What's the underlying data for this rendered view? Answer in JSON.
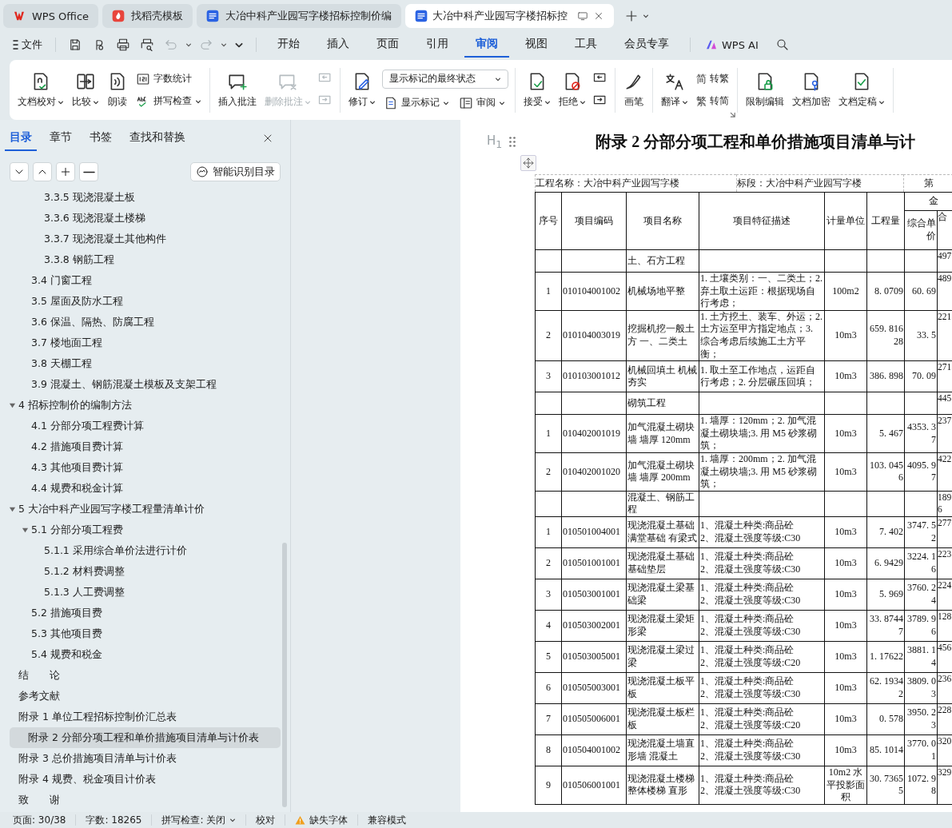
{
  "browser_tabs": [
    {
      "kind": "app",
      "label": "WPS Office",
      "selected": false
    },
    {
      "kind": "template",
      "label": "找稻壳模板",
      "selected": false
    },
    {
      "kind": "document",
      "label": "大冶中科产业园写字楼招标控制价编",
      "selected": false
    },
    {
      "kind": "document",
      "label": "大冶中科产业园写字楼招标控",
      "selected": true
    }
  ],
  "menu": {
    "file": "文件",
    "quick_actions": [
      {
        "disabled": false
      },
      {
        "disabled": false
      },
      {
        "disabled": false
      },
      {
        "disabled": false
      },
      {
        "disabled": true
      },
      {
        "disabled": true
      },
      {
        "disabled": false
      }
    ],
    "tabs": [
      {
        "label": "开始",
        "selected": false
      },
      {
        "label": "插入",
        "selected": false
      },
      {
        "label": "页面",
        "selected": false
      },
      {
        "label": "引用",
        "selected": false
      },
      {
        "label": "审阅",
        "selected": true
      },
      {
        "label": "视图",
        "selected": false
      },
      {
        "label": "工具",
        "selected": false
      },
      {
        "label": "会员专享",
        "selected": false
      }
    ],
    "ai": "WPS AI"
  },
  "ribbon": {
    "groups": [
      {
        "items": [
          {
            "kind": "large",
            "label": "文档校对",
            "dropdown": true,
            "disabled": false
          },
          {
            "kind": "large",
            "label": "比较",
            "dropdown": true,
            "disabled": false
          },
          {
            "kind": "large",
            "label": "朗读",
            "dropdown": false,
            "disabled": false
          },
          {
            "kind": "small",
            "label": "字数统计",
            "dropdown": false,
            "disabled": false
          },
          {
            "kind": "small",
            "label": "拼写检查",
            "dropdown": true,
            "disabled": false
          }
        ]
      },
      {
        "items": [
          {
            "kind": "large",
            "label": "插入批注",
            "dropdown": false,
            "disabled": false
          },
          {
            "kind": "large",
            "label": "删除批注",
            "dropdown": true,
            "disabled": true
          },
          {
            "kind": "icon",
            "disabled": true
          },
          {
            "kind": "icon",
            "disabled": true
          }
        ]
      },
      {
        "items": [
          {
            "kind": "large",
            "label": "修订",
            "dropdown": true,
            "disabled": false
          },
          {
            "kind": "select",
            "value": "显示标记的最终状态",
            "disabled": false
          },
          {
            "kind": "small",
            "label": "显示标记",
            "dropdown": true,
            "disabled": false
          },
          {
            "kind": "small",
            "label": "审阅",
            "dropdown": true,
            "disabled": false
          }
        ]
      },
      {
        "items": [
          {
            "kind": "large",
            "label": "接受",
            "dropdown": true,
            "disabled": false
          },
          {
            "kind": "large",
            "label": "拒绝",
            "dropdown": true,
            "disabled": false
          },
          {
            "kind": "icon",
            "disabled": false
          },
          {
            "kind": "icon",
            "disabled": false
          }
        ]
      },
      {
        "items": [
          {
            "kind": "large",
            "label": "画笔",
            "dropdown": false,
            "disabled": false
          }
        ]
      },
      {
        "launcher": true,
        "items": [
          {
            "kind": "large",
            "label": "翻译",
            "dropdown": true,
            "disabled": false
          },
          {
            "kind": "small",
            "glyph": "简",
            "label": "转繁",
            "dropdown": false,
            "disabled": false
          },
          {
            "kind": "small",
            "glyph": "繁",
            "label": "转简",
            "dropdown": false,
            "disabled": false
          }
        ]
      },
      {
        "items": [
          {
            "kind": "large",
            "label": "限制编辑",
            "dropdown": false,
            "disabled": false
          },
          {
            "kind": "large",
            "label": "文档加密",
            "dropdown": false,
            "disabled": false
          },
          {
            "kind": "large",
            "label": "文档定稿",
            "dropdown": true,
            "disabled": false
          }
        ]
      }
    ]
  },
  "sidebar": {
    "tabs": [
      {
        "label": "目录",
        "selected": true
      },
      {
        "label": "章节",
        "selected": false
      },
      {
        "label": "书签",
        "selected": false
      },
      {
        "label": "查找和替换",
        "selected": false
      }
    ],
    "smart_button": "智能识别目录",
    "outline": [
      {
        "children": [
          {
            "children": [
              {
                "label": "3.3.5 现浇混凝土板",
                "selected": false
              },
              {
                "label": "3.3.6 现浇混凝土楼梯",
                "selected": false
              },
              {
                "label": "3.3.7 现浇混凝土其他构件",
                "selected": false
              },
              {
                "label": "3.3.8 钢筋工程",
                "selected": false
              }
            ]
          },
          {
            "label": "3.4 门窗工程",
            "selected": false
          },
          {
            "label": "3.5 屋面及防水工程",
            "selected": false
          },
          {
            "label": "3.6 保温、隔热、防腐工程",
            "selected": false
          },
          {
            "label": "3.7 楼地面工程",
            "selected": false
          },
          {
            "label": "3.8 天棚工程",
            "selected": false
          },
          {
            "label": "3.9 混凝土、钢筋混凝土模板及支架工程",
            "selected": false
          }
        ]
      },
      {
        "label": "4 招标控制价的编制方法",
        "expanded": true,
        "selected": false,
        "children": [
          {
            "label": "4.1 分部分项工程费计算",
            "selected": false
          },
          {
            "label": "4.2 措施项目费计算",
            "selected": false
          },
          {
            "label": "4.3 其他项目费计算",
            "selected": false
          },
          {
            "label": "4.4 规费和税金计算",
            "selected": false
          }
        ]
      },
      {
        "label": "5 大冶中科产业园写字楼工程量清单计价",
        "expanded": true,
        "selected": false,
        "children": [
          {
            "label": "5.1 分部分项工程费",
            "expanded": true,
            "selected": false,
            "children": [
              {
                "label": "5.1.1 采用综合单价法进行计价",
                "selected": false
              },
              {
                "label": "5.1.2 材料费调整",
                "selected": false
              },
              {
                "label": "5.1.3 人工费调整",
                "selected": false
              }
            ]
          },
          {
            "label": "5.2 措施项目费",
            "selected": false
          },
          {
            "label": "5.3 其他项目费",
            "selected": false
          },
          {
            "label": "5.4 规费和税金",
            "selected": false
          }
        ]
      },
      {
        "label": "结　　论",
        "selected": false
      },
      {
        "label": "参考文献",
        "selected": false
      },
      {
        "label": "附录 1 单位工程招标控制价汇总表",
        "selected": false
      },
      {
        "label": "附录 2 分部分项工程和单价措施项目清单与计价表",
        "selected": true
      },
      {
        "label": "附录 3 总价措施项目清单与计价表",
        "selected": false
      },
      {
        "label": "附录 4 规费、税金项目计价表",
        "selected": false
      },
      {
        "label": "致　　谢",
        "selected": false
      }
    ]
  },
  "document": {
    "heading_marker": "H$_{1}$",
    "title": "附录 2 分部分项工程和单价措施项目清单与计",
    "info": [
      "工程名称：大冶中科产业园写字楼",
      "标段：大冶中科产业园写字楼",
      "第"
    ],
    "table": {
      "columns": [
        "序号",
        "项目编码",
        "项目名称",
        "项目特征描述",
        "计量单位",
        "工程量"
      ],
      "amount_group": "金",
      "amount_columns": [
        "综合单价",
        "合"
      ],
      "rows": [
        {
          "kind": "section",
          "name": "土、石方工程",
          "total": "497"
        },
        {
          "kind": "item",
          "cells": [
            "1",
            "010104001002",
            "机械场地平整",
            "1. 土壤类别：一、二类土；2. 弃土取土运距：根据现场自行考虑；",
            "100m2",
            "8. 0709",
            "60. 69",
            "489"
          ]
        },
        {
          "kind": "item",
          "cells": [
            "2",
            "010104003019",
            "挖掘机挖一般土方 一、二类土",
            "1. 土方挖土、装车、外运；2. 土方运至甲方指定地点；3. 综合考虑后续施工土方平衡；",
            "10m3",
            "659. 81628",
            "33. 5",
            "221"
          ]
        },
        {
          "kind": "item",
          "cells": [
            "3",
            "010103001012",
            "机械回填土 机械夯实",
            "1. 取土至工作地点，运距自行考虑；2. 分层碾压回填；",
            "10m3",
            "386. 898",
            "70. 09",
            "271"
          ]
        },
        {
          "kind": "section",
          "name": "砌筑工程",
          "total": "445"
        },
        {
          "kind": "item",
          "cells": [
            "1",
            "010402001019",
            "加气混凝土砌块墙 墙厚 120mm",
            "1. 墙厚：120mm；2. 加气混凝土砌块墙;3. 用 M5 砂浆砌筑；",
            "10m3",
            "5. 467",
            "4353. 37",
            "237"
          ]
        },
        {
          "kind": "item",
          "cells": [
            "2",
            "010402001020",
            "加气混凝土砌块墙 墙厚 200mm",
            "1. 墙厚：200mm；2. 加气混凝土砌块墙;3. 用 M5 砂浆砌筑；",
            "10m3",
            "103. 0456",
            "4095. 97",
            "422"
          ]
        },
        {
          "kind": "section",
          "name": "混凝土、钢筋工程",
          "total": "1896"
        },
        {
          "kind": "item",
          "cells": [
            "1",
            "010501004001",
            "现浇混凝土基础满堂基础 有梁式",
            "1、混凝土种类:商品砼\n2、混凝土强度等级:C30",
            "10m3",
            "7. 402",
            "3747. 52",
            "277"
          ]
        },
        {
          "kind": "item",
          "cells": [
            "2",
            "010501001001",
            "现浇混凝土基础基础垫层",
            "1、混凝土种类:商品砼\n2、混凝土强度等级:C30",
            "10m3",
            "6. 9429",
            "3224. 16",
            "223"
          ]
        },
        {
          "kind": "item",
          "cells": [
            "3",
            "010503001001",
            "现浇混凝土梁基础梁",
            "1、混凝土种类:商品砼\n2、混凝土强度等级:C30",
            "10m3",
            "5. 969",
            "3760. 24",
            "224"
          ]
        },
        {
          "kind": "item",
          "cells": [
            "4",
            "010503002001",
            "现浇混凝土梁矩形梁",
            "1、混凝土种类:商品砼\n2、混凝土强度等级:C30",
            "10m3",
            "33. 87447",
            "3789. 96",
            "128"
          ]
        },
        {
          "kind": "item",
          "cells": [
            "5",
            "010503005001",
            "现浇混凝土梁过梁",
            "1、混凝土种类:商品砼\n2、混凝土强度等级:C20",
            "10m3",
            "1. 17622",
            "3881. 14",
            "456"
          ]
        },
        {
          "kind": "item",
          "cells": [
            "6",
            "010505003001",
            "现浇混凝土板平板",
            "1、混凝土种类:商品砼\n2、混凝土强度等级:C30",
            "10m3",
            "62. 19342",
            "3809. 03",
            "236"
          ]
        },
        {
          "kind": "item",
          "cells": [
            "7",
            "010505006001",
            "现浇混凝土板栏板",
            "1、混凝土种类:商品砼\n2、混凝土强度等级:C20",
            "10m3",
            "0. 578",
            "3950. 23",
            "228"
          ]
        },
        {
          "kind": "item",
          "cells": [
            "8",
            "010504001002",
            "现浇混凝土墙直形墙 混凝土",
            "1、混凝土种类:商品砼\n2、混凝土强度等级:C30",
            "10m3",
            "85. 1014",
            "3770. 01",
            "320"
          ]
        },
        {
          "kind": "item",
          "cells": [
            "9",
            "010506001001",
            "现浇混凝土楼梯整体楼梯 直形",
            "1、混凝土种类:商品砼\n2、混凝土强度等级:C30",
            "10m2 水平投影面积",
            "30. 73655",
            "1072. 98",
            "329"
          ]
        }
      ]
    }
  },
  "status_bar": {
    "items": [
      {
        "kind": "text",
        "label": "页面: 30/38"
      },
      {
        "kind": "text",
        "label": "字数: 18265"
      },
      {
        "kind": "dropdown",
        "label": "拼写检查: 关闭"
      },
      {
        "kind": "text",
        "label": "校对"
      },
      {
        "kind": "warning",
        "label": "缺失字体"
      },
      {
        "kind": "text",
        "label": "兼容模式"
      }
    ]
  }
}
